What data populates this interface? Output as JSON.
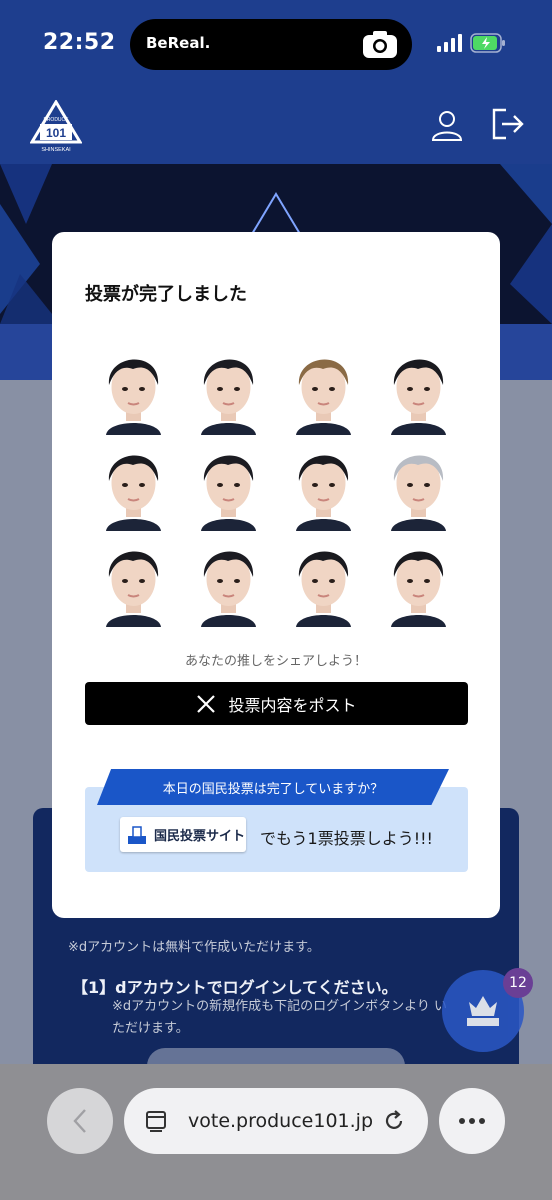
{
  "status_bar": {
    "time": "22:52",
    "app": "BeReal."
  },
  "header": {
    "logo_text": "PRODUCE 101",
    "logo_sub": "SHINSEKAI"
  },
  "modal": {
    "title": "投票が完了しました",
    "share_text": "あなたの推しをシェアしよう！",
    "post_label": "投票内容をポスト",
    "vote_banner": "本日の国民投票は完了していますか？",
    "vote_site_label": "国民投票サイト",
    "vote_cta": "でもう1票投票しよう!!!"
  },
  "faces": [
    {
      "hair": "#1a1a1f"
    },
    {
      "hair": "#1c1c22"
    },
    {
      "hair": "#8a6a45"
    },
    {
      "hair": "#1a1a1f"
    },
    {
      "hair": "#1a1a1f"
    },
    {
      "hair": "#1c1c22"
    },
    {
      "hair": "#1a1a1f"
    },
    {
      "hair": "#b8bcc4"
    },
    {
      "hair": "#1a1a1f"
    },
    {
      "hair": "#1c1c22"
    },
    {
      "hair": "#1a1a1f"
    },
    {
      "hair": "#1a1a1f"
    }
  ],
  "background": {
    "note": "※dアカウントは無料で作成いただけます。",
    "step": "【1】dアカウントでログインしてください。",
    "sub": "※dアカウントの新規作成も下記のログインボタンより いただけます。"
  },
  "fab": {
    "badge": "12"
  },
  "browser": {
    "url": "vote.produce101.jp"
  },
  "colors": {
    "brand_blue": "#1e3e8e",
    "ribbon_blue": "#1a56c8",
    "vote_box": "#cfe2fa"
  }
}
